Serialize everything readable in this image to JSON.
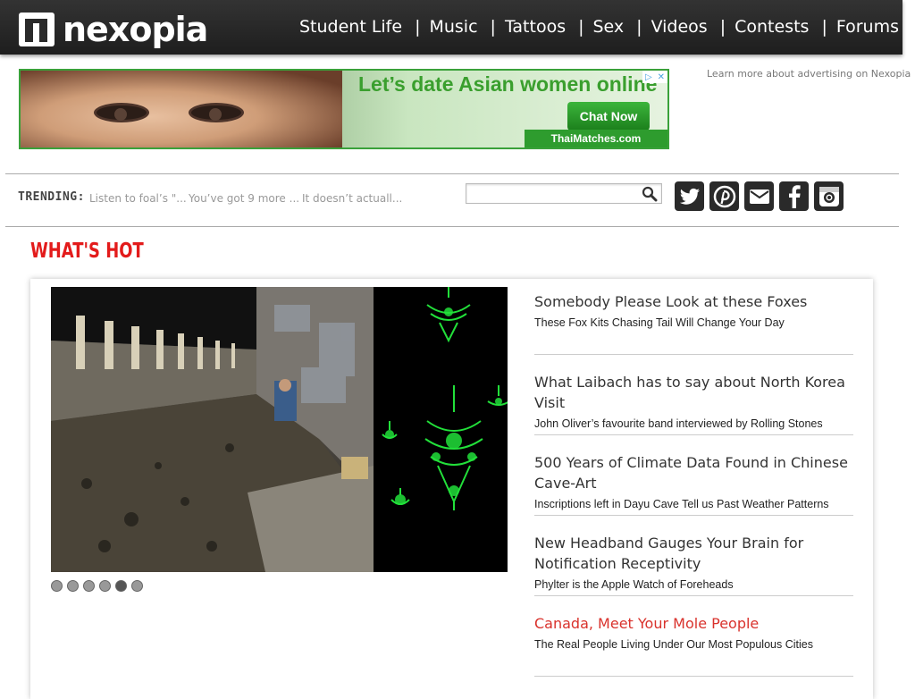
{
  "header": {
    "logo_text": "nexopia",
    "nav": [
      "Student Life",
      "Music",
      "Tattoos",
      "Sex",
      "Videos",
      "Contests",
      "Forums"
    ]
  },
  "ad": {
    "headline": "Let’s date Asian women online",
    "cta": "Chat Now",
    "domain": "ThaiMatches.com",
    "learn_more": "Learn more about advertising on Nexopia"
  },
  "trending": {
    "label": "TRENDING:",
    "items": [
      "Listen to foal’s \"...",
      "You’ve got 9 more ...",
      "It doesn’t actuall..."
    ]
  },
  "search": {
    "placeholder": ""
  },
  "social": [
    "twitter-icon",
    "pinterest-icon",
    "email-icon",
    "facebook-icon",
    "instagram-icon"
  ],
  "hot": {
    "title": "WHAT'S HOT",
    "slides_count": 6,
    "active_slide": 5,
    "stories": [
      {
        "title": "Somebody Please Look at these Foxes",
        "sub": "These Fox Kits Chasing Tail Will Change Your Day"
      },
      {
        "title": "What Laibach has to say about North Korea Visit",
        "sub": "John Oliver’s favourite band interviewed by Rolling Stones"
      },
      {
        "title": "500 Years of Climate Data Found in Chinese Cave-Art",
        "sub": "Inscriptions left in Dayu Cave Tell us Past Weather Patterns"
      },
      {
        "title": "New Headband Gauges Your Brain for Notification Receptivity",
        "sub": "Phylter is the Apple Watch of Foreheads"
      },
      {
        "title": "Canada, Meet Your Mole People",
        "sub": "The Real People Living Under Our Most Populous Cities"
      }
    ]
  },
  "colors": {
    "accent_red": "#e31b1b",
    "link_red": "#d9322c",
    "header_bg": "#2a2a2a"
  }
}
